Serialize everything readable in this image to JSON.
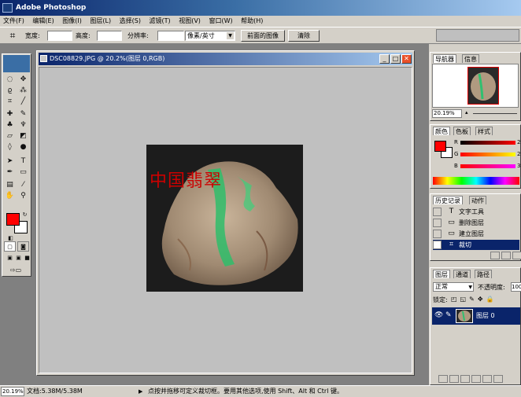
{
  "app": {
    "title": "Adobe Photoshop"
  },
  "menu": [
    "文件(F)",
    "编辑(E)",
    "图像(I)",
    "图层(L)",
    "选择(S)",
    "滤镜(T)",
    "视图(V)",
    "窗口(W)",
    "帮助(H)"
  ],
  "options": {
    "width_label": "宽度:",
    "height_label": "高度:",
    "resolution_label": "分辨率:",
    "unit_value": "像素/英寸",
    "front_image_button": "前面的图像",
    "clear_button": "清除"
  },
  "document": {
    "title": "DSC08829.JPG @ 20.2%(图层 0,RGB)",
    "watermark": "中国翡翠"
  },
  "navigator": {
    "tabs": [
      "导航器",
      "信息"
    ],
    "zoom": "20.19%"
  },
  "color": {
    "tabs": [
      "颜色",
      "色板",
      "样式"
    ],
    "channels": [
      {
        "label": "R",
        "value": "2"
      },
      {
        "label": "G",
        "value": "2"
      },
      {
        "label": "B",
        "value": "3"
      }
    ],
    "foreground": "#ff0000"
  },
  "history": {
    "tabs": [
      "历史记录",
      "动作"
    ],
    "items": [
      {
        "label": "文字工具",
        "icon": "T"
      },
      {
        "label": "删除图层",
        "icon": "▭"
      },
      {
        "label": "建立图层",
        "icon": "▭"
      },
      {
        "label": "裁切",
        "icon": "⌗"
      }
    ],
    "selected_index": 3
  },
  "layers": {
    "tabs": [
      "图层",
      "通道",
      "路径"
    ],
    "blend_mode": "正常",
    "opacity_label": "不透明度:",
    "opacity_value": "100",
    "lock_label": "锁定:",
    "layer_name": "图层 0"
  },
  "status": {
    "zoom": "20.19%",
    "doc_size": "文档:5.38M/5.38M",
    "hint": "点按并拖移可定义裁切框。要用其他选项,使用 Shift、Alt 和 Ctrl 键。"
  }
}
